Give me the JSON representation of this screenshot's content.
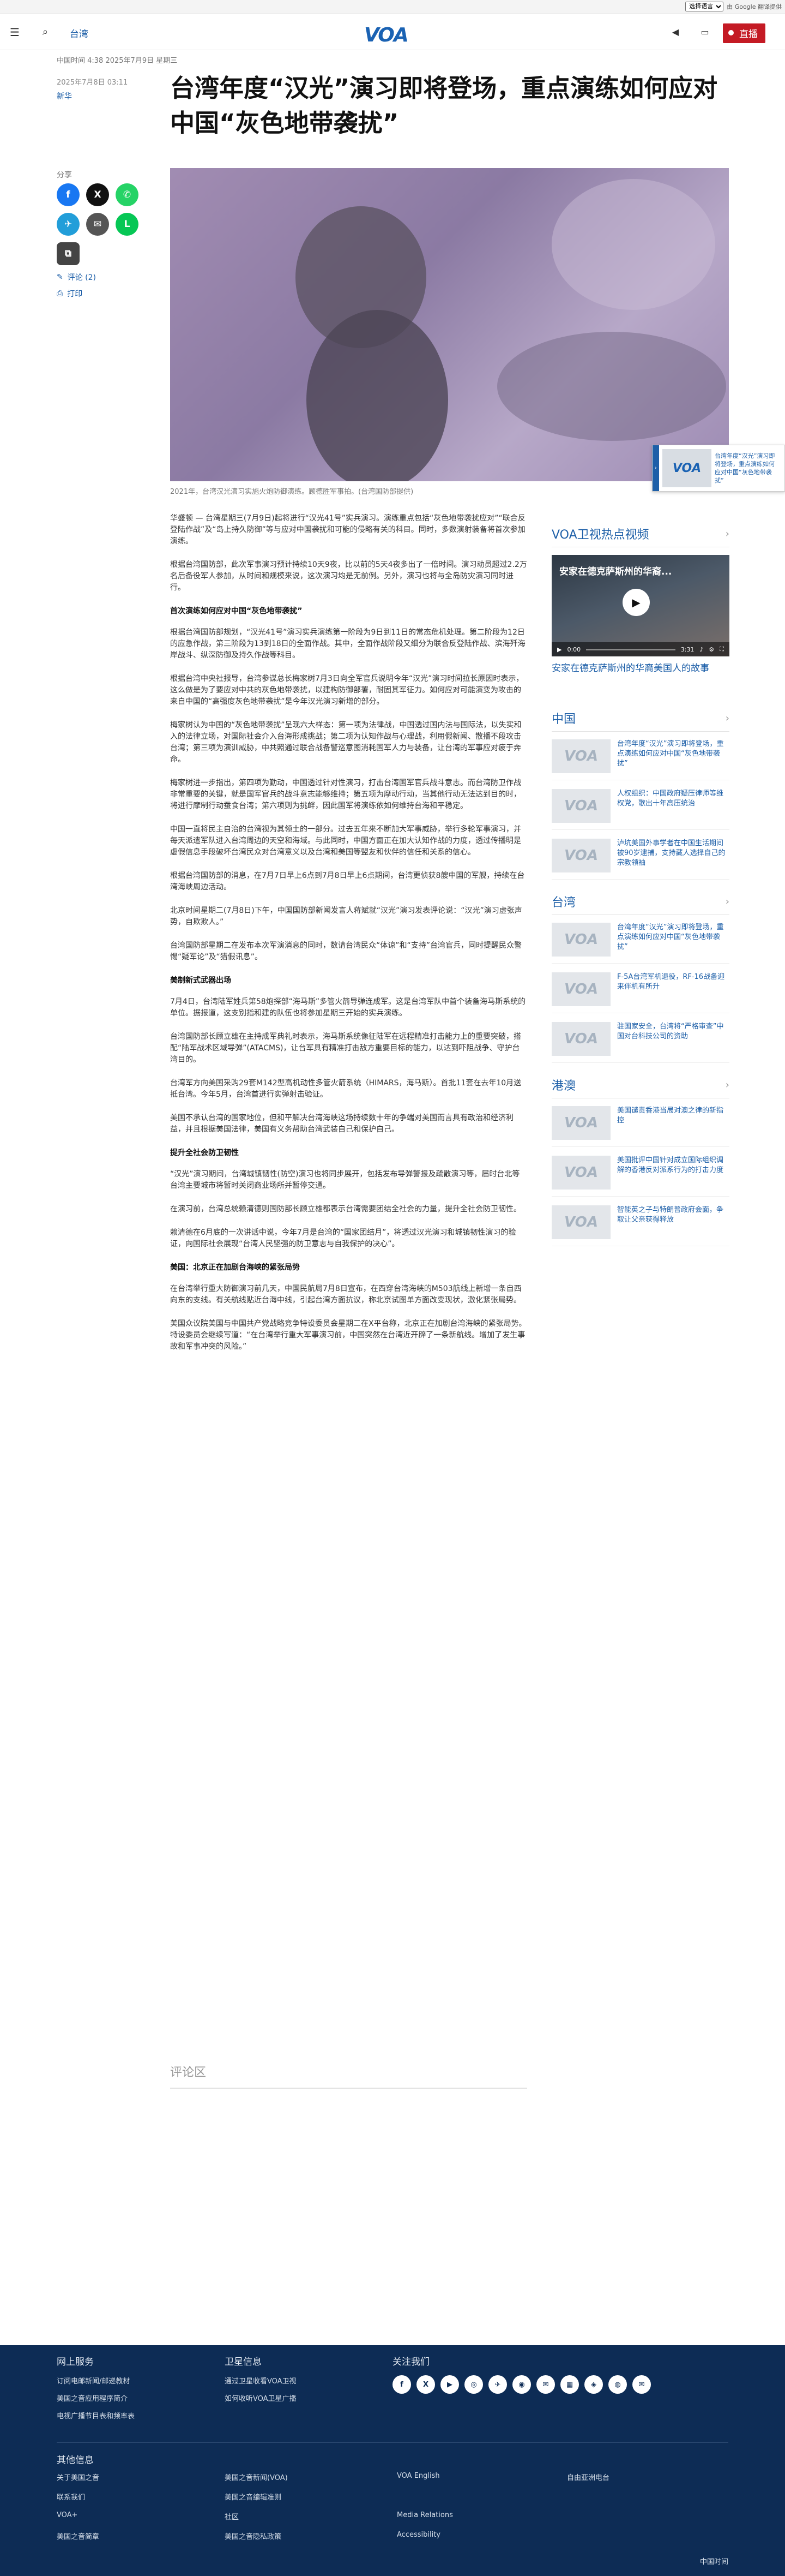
{
  "translate": {
    "select": "选择语言",
    "powered": "由 Google 翻译提供"
  },
  "header": {
    "section": "台湾",
    "live_label": "直播"
  },
  "article": {
    "meta": "中国时间 4:38 2025年7月9日 星期三",
    "date": "2025年7月8日 03:11",
    "author": "新华",
    "title": "台湾年度“汉光”演习即将登场，重点演练如何应对中国“灰色地带袭扰”",
    "share_label": "分享",
    "comments_link": "评论 (2)",
    "print_link": "打印",
    "caption": "2021年，台湾汉光演习实施火炮防御演练。顾德胜军事拍。(台湾国防部提供)",
    "paragraphs": [
      "华盛顿 — 台湾星期三(7月9日)起将进行“汉光41号”实兵演习。演练重点包括“灰色地带袭扰应对”“联合反登陆作战”及“岛上持久防御”等与应对中国袭扰和可能的侵略有关的科目。同时，多数演射装备将首次参加演练。",
      "根据台湾国防部，此次军事演习预计持续10天9夜，比以前的5天4夜多出了一倍时间。演习动员超过2.2万名后备役军人参加，从时间和规模来说，这次演习均是无前例。另外，演习也将与全岛防灾演习同时进行。"
    ],
    "h1": "首次演练如何应对中国“灰色地带袭扰”",
    "paragraphs2": [
      "根据台湾国防部规划，“汉光41号”演习实兵演练第一阶段为9日到11日的常态危机处理。第二阶段为12日的应急作战，第三阶段为13到18日的全面作战。其中，全面作战阶段又细分为联合反登陆作战、滨海歼海岸战斗、纵深防御及持久作战等科目。",
      "根据台湾中央社报导，台湾参谋总长梅家树7月3日向全军官兵说明今年“汉光”演习时间拉长原因时表示，这么做是为了要应对中共的灰色地带袭扰，以建构防御部署，耐固其军征力。如何应对可能演变为攻击的来自中国的“高强度灰色地带袭扰”是今年汉光演习新增的部分。",
      "梅家树认为中国的“灰色地带袭扰”呈现六大样态：第一项为法律战，中国透过国内法与国际法，以失实和入的法律立场，对国际社会介入台海形成挑战；第二项为认知作战与心理战，利用假新闻、散播不段攻击台湾；第三项为演训威胁，中共照通过联合战备警巡意图消耗国军人力与装备，让台湾的军事应对疲于奔命。",
      "梅家树进一步指出，第四项为勤动，中国透过针对性演习，打击台湾国军官兵战斗意志。而台湾防卫作战非常重要的关键，就是国军官兵的战斗意志能够维持；第五项为摩动行动，当其他行动无法达到目的时，将进行摩制行动蚕食台湾；第六项则为挑衅，因此国军将演练依如何维持台海和平稳定。",
      "中国一直将民主自治的台湾视为其领土的一部分。过去五年来不断加大军事威胁，举行多轮军事演习，并每天派遣军队进入台湾周边的天空和海域。与此同时，中国方面正在加大认知作战的力度，透过传播明是虚假信息手段破坏台湾民众对台湾意义以及台湾和美国等盟友和伙伴的信任和关系的信心。",
      "根据台湾国防部的消息，在7月7日早上6点到7月8日早上6点期间，台湾更侦获8艘中国的军舰，持续在台湾海峡周边活动。",
      "北京时间星期二(7月8日)下午，中国国防部新闻发言人蒋斌就“汉光”演习发表评论说：“汉光”演习虚张声势，自欺欺人。”",
      "台湾国防部星期二在发布本次军演消息的同时，数请台湾民众“体谅”和“支持”台湾官兵，同时提醒民众警惕“疑军论”及“猎假讯息”。"
    ],
    "h2": "美制新式武器出场",
    "paragraphs3": [
      "7月4日，台湾陆军姓兵第58炮探部“海马斯”多管火箭导弹连成军。这是台湾军队中首个装备海马斯系统的单位。据报道，这支别指和建的队伍也将参加星期三开始的实兵演练。",
      "台湾国防部长顾立雄在主持成军典礼时表示，海马斯系统像征陆军在远程精准打击能力上的重要突破，搭配“陆军战术区域导弹”(ATACMS)，让台军具有精准打击敌方重要目标的能力，以达到吓阻战争、守护台湾目的。",
      "台湾军方向美国采购29套M142型高机动性多管火箭系统（HIMARS，海马斯）。首批11套在去年10月送抵台湾。今年5月，台湾首进行实弹射击验证。",
      "美国不承认台湾的国家地位，但和平解决台湾海峡这场持续数十年的争端对美国而言具有政治和经济利益，并且根据美国法律，美国有义务帮助台湾武装自己和保护自己。"
    ],
    "h3": "提升全社会防卫韧性",
    "paragraphs4": [
      "“汉光”演习期间，台湾城镇韧性(防空)演习也将同步展开，包括发布导弹警报及疏散演习等，届时台北等台湾主要城市将暂时关闭商业场所并暂停交通。",
      "在演习前，台湾总统赖清德则国防部长顾立雄都表示台湾需要团结全社会的力量，提升全社会防卫韧性。",
      "赖清德在6月底的一次讲话中说，今年7月是台湾的“国家团结月”，将透过汉光演习和城镇韧性演习的验证，向国际社会展现“台湾人民坚强的防卫意志与自我保护的决心”。"
    ],
    "h4": "美国：北京正在加剧台海峡的紧张局势",
    "paragraphs5": [
      "在台湾举行重大防御演习前几天，中国民航局7月8日宣布，在西穿台湾海峡的M503航线上新增一条自西向东的支线。有关航线贴近台海中线，引起台湾方面抗议，称北京试图单方面改变现状，激化紧张局势。",
      "美国众议院美国与中国共产党战略竞争特设委员会星期二在X平台称，北京正在加剧台湾海峡的紧张局势。特设委员会继续写道：“在台湾举行重大军事演习前，中国突然在台湾近开辟了一条新航线。增加了发生事故和军事冲突的风险。”"
    ],
    "comments_heading": "评论区"
  },
  "sidebar": {
    "video_heading": "VOA卫视热点视频",
    "video_title": "安家在德克萨斯州的华裔...",
    "video_time_current": "0:00",
    "video_time_total": "3:31",
    "video_caption": "安家在德克萨斯州的华裔美国人的故事",
    "china_heading": "中国",
    "china_items": [
      "台湾年度“汉光”演习即将登场，重点演练如何应对中国“灰色地带袭扰”",
      "人权组织：中国政府疑压律师等维权党，歌出十年高压统治",
      "泸坑美国外事学者在中国生活期间被90岁逮捕，支持藏人选择自己的宗教领袖"
    ],
    "taiwan_heading": "台湾",
    "taiwan_items": [
      "台湾年度“汉光”演习即将登场，重点演练如何应对中国“灰色地带袭扰”",
      "F-5A台湾军机退役，RF-16战备迎来伴机有所升",
      "驻国家安全，台湾将“严格审查”中国对台科技公司的资助"
    ],
    "hk_heading": "港澳",
    "hk_items": [
      "美国谴责香港当局对澳之律的新指控",
      "美国批评中国针对成立国际组织调解的香港反对派系行为的打击力度",
      "智能英之子与特朗普政府会面，争取让父亲获得释放"
    ]
  },
  "footer": {
    "col1_heading": "网上服务",
    "col1_links": [
      "订阅电邮新闻/邮递教材",
      "美国之音应用程序简介",
      "电视广播节目表和频率表"
    ],
    "col2_heading": "卫星信息",
    "col2_links": [
      "通过卫星收看VOA卫视",
      "如何收听VOA卫星广播"
    ],
    "col3_heading": "关注我们",
    "social": [
      "f",
      "X",
      "▶",
      "◎",
      "✈",
      "◉",
      "✉",
      "▦",
      "◈",
      "◍",
      "✉"
    ],
    "about_heading": "其他信息",
    "grid": [
      [
        "关于美国之音",
        "美国之音新闻(VOA)",
        "VOA English",
        "自由亚洲电台"
      ],
      [
        "联系我们",
        "美国之音编辑准则",
        "",
        ""
      ],
      [
        "VOA+",
        "社区",
        "Media Relations",
        ""
      ],
      [
        "美国之音简章",
        "美国之音隐私政策",
        "Accessibility",
        ""
      ]
    ],
    "copyright": "中国时间"
  }
}
